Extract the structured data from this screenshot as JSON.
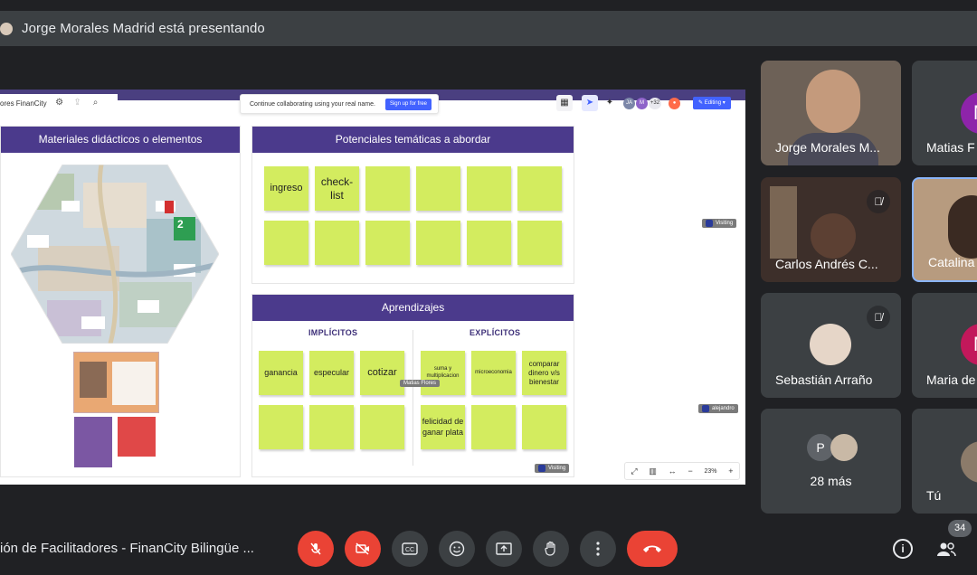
{
  "top_bar": {
    "presenter_text": "Jorge Morales Madrid está presentando"
  },
  "board": {
    "board_name": "ores FinanCity",
    "collab_text": "Continue collaborating using your real name.",
    "signup_label": "Sign up for free",
    "collaborator_count": "+32",
    "editing_label": "Editing",
    "zoom": "23%",
    "frames": {
      "materiales": {
        "title": "Materiales didácticos o elementos"
      },
      "potenciales": {
        "title": "Potenciales temáticas a abordar",
        "stickies": [
          "ingreso",
          "check-list",
          "",
          "",
          "",
          "",
          "",
          "",
          "",
          "",
          "",
          ""
        ]
      },
      "aprendizajes": {
        "title": "Aprendizajes",
        "implicitos_label": "IMPLÍCITOS",
        "explicitos_label": "EXPLÍCITOS",
        "implicitos_stickies": [
          "ganancia",
          "especular",
          "cotizar",
          "",
          "",
          ""
        ],
        "explicitos_stickies": [
          "suma y multiplicacion",
          "microeconomia",
          "comparar dinero v/s bienestar",
          "felicidad de ganar plata",
          "",
          ""
        ]
      }
    },
    "map_badge": "2",
    "cursors": {
      "visiting_1": "Visiting",
      "alejandro": "alejandro",
      "matias": "Matias Flores",
      "visiting_2": "Visiting"
    }
  },
  "participants": [
    {
      "name": "Jorge Morales M...",
      "muted": false
    },
    {
      "name": "Matias F",
      "initial": "M",
      "color": "#8e24aa",
      "muted": false
    },
    {
      "name": "Carlos Andrés C...",
      "muted": true
    },
    {
      "name": "Catalina",
      "muted": false
    },
    {
      "name": "Sebastián Arraño",
      "muted": true
    },
    {
      "name": "Maria de",
      "initial": "M",
      "color": "#c2185b",
      "muted": false
    },
    {
      "name": "28 más",
      "initial": "P"
    },
    {
      "name": "Tú"
    }
  ],
  "bottom_bar": {
    "meeting_name": "ión de Facilitadores - FinanCity Bilingüe ...",
    "people_count": "34"
  },
  "colors": {
    "frame_header": "#4b3a8c",
    "sticky": "#d3ec5f",
    "danger": "#ea4335",
    "background": "#202124",
    "tile": "#3c4043"
  }
}
